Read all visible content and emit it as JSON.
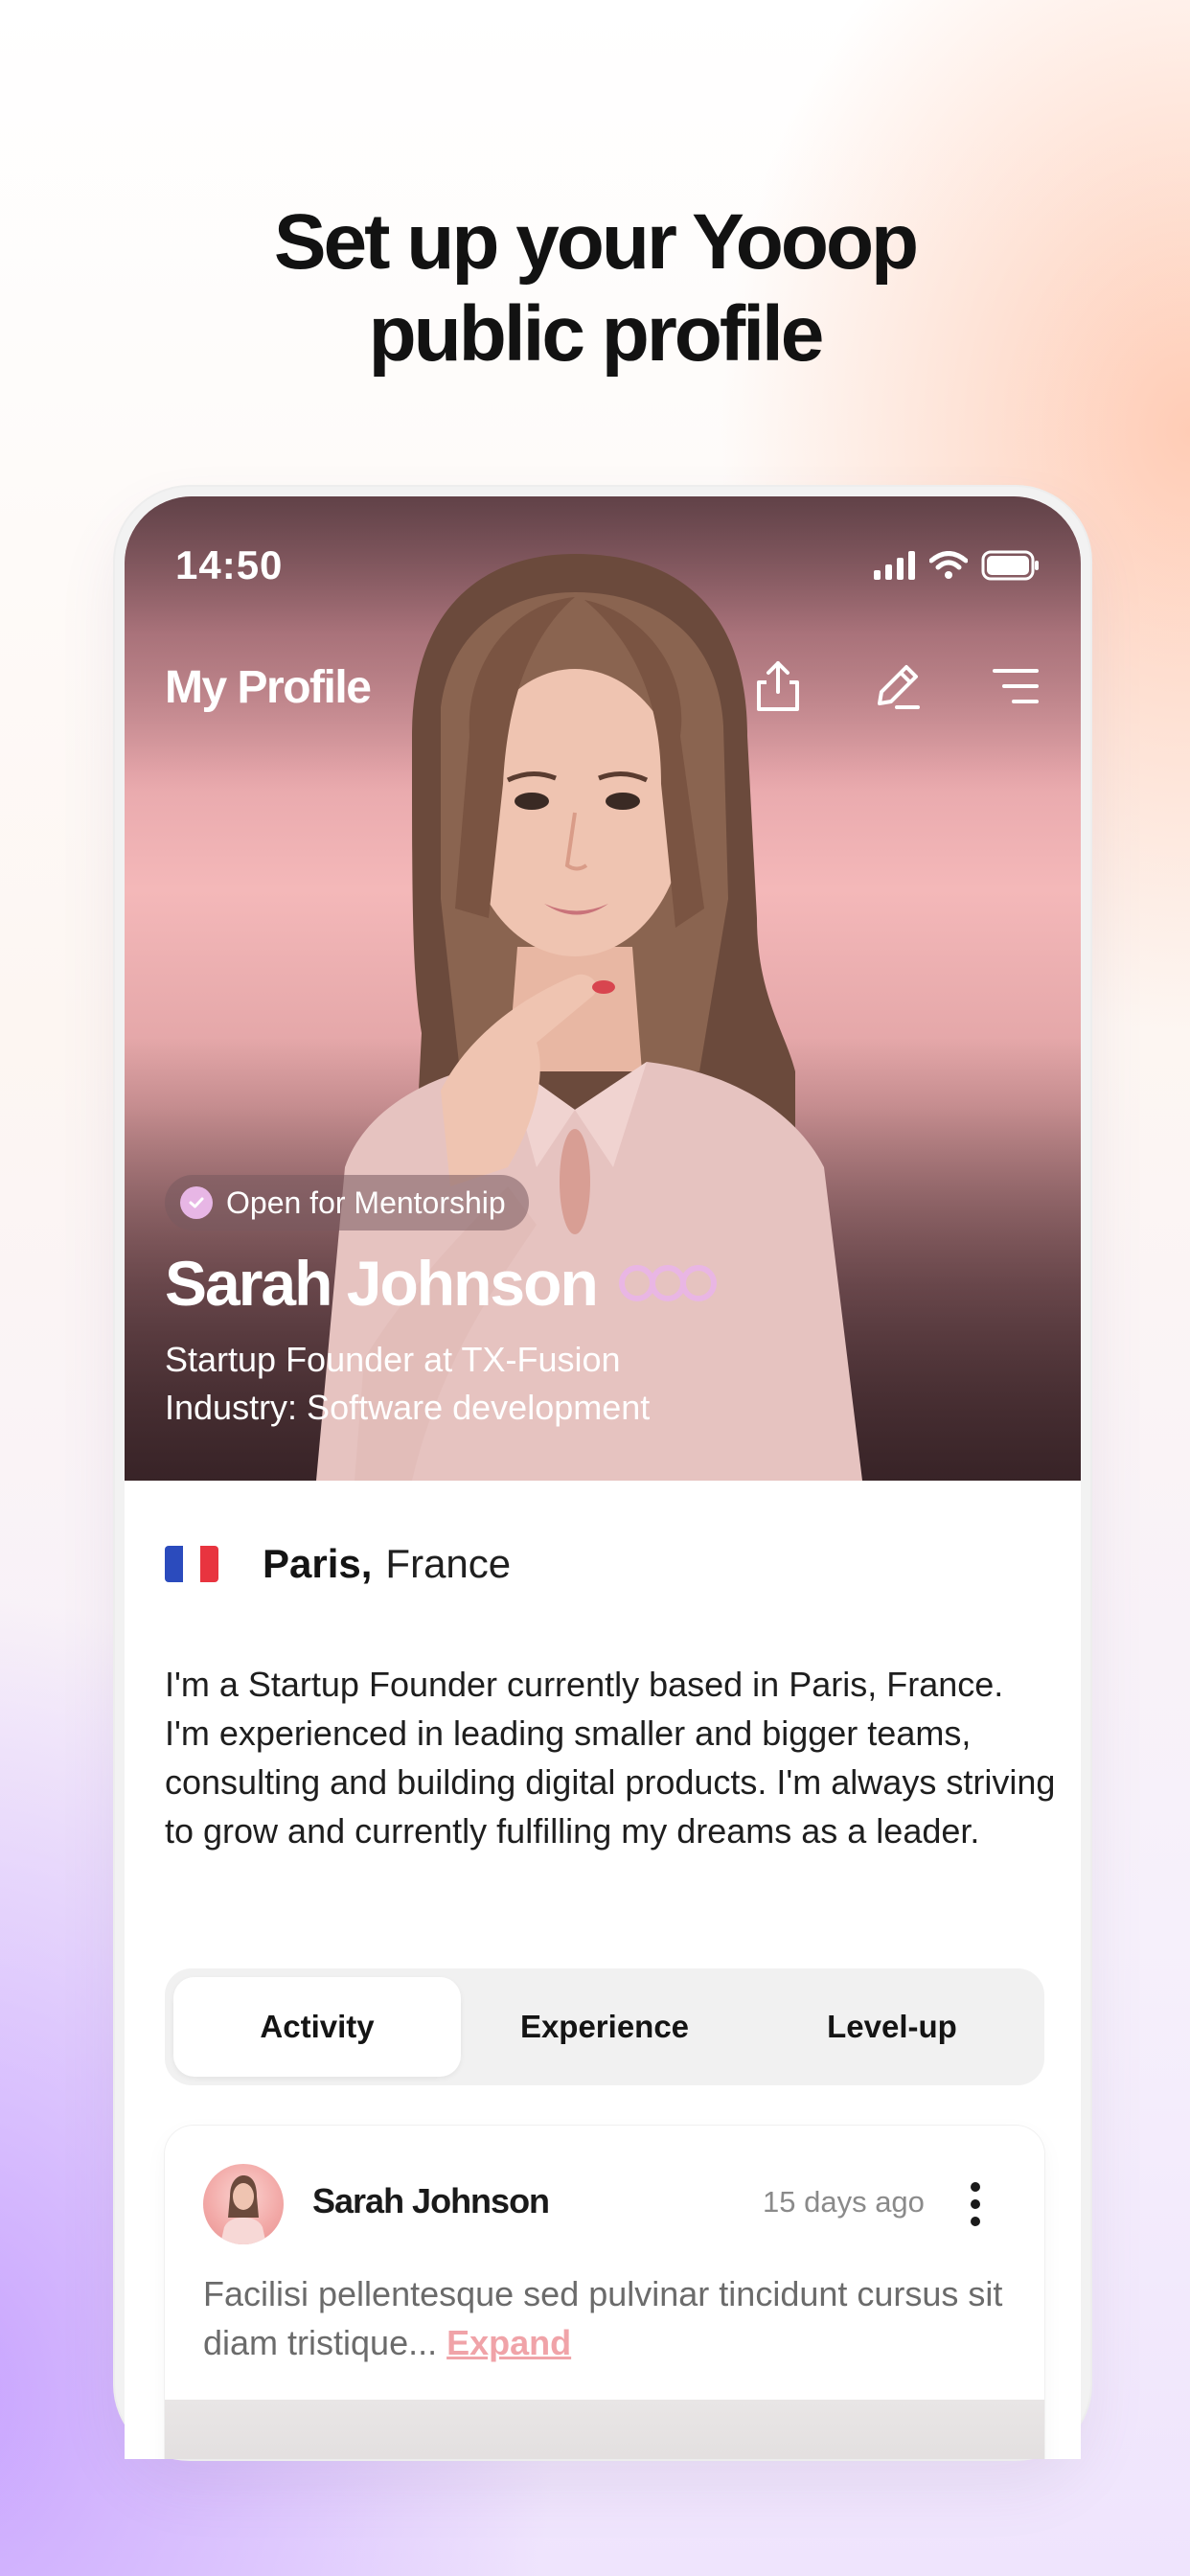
{
  "headline": {
    "line1": "Set up your  Yooop",
    "line2": "public profile"
  },
  "status_bar": {
    "time": "14:50",
    "icons": [
      "signal-icon",
      "wifi-icon",
      "battery-icon"
    ]
  },
  "header": {
    "title": "My Profile",
    "actions": [
      {
        "icon": "share-icon"
      },
      {
        "icon": "edit-icon"
      },
      {
        "icon": "menu-icon"
      }
    ]
  },
  "profile": {
    "badge": "Open for Mentorship",
    "name": "Sarah Johnson",
    "headline": "Startup Founder at TX-Fusion",
    "industry": "Industry: Software development",
    "city": "Paris",
    "country": "France",
    "bio": "I'm a Startup Founder currently based in Paris, France. I'm experienced in leading smaller and bigger teams, consulting and building digital products. I'm always striving to grow and currently fulfilling my dreams as a leader."
  },
  "tabs": [
    {
      "label": "Activity",
      "active": true
    },
    {
      "label": "Experience",
      "active": false
    },
    {
      "label": "Level-up",
      "active": false
    }
  ],
  "post": {
    "author": "Sarah Johnson",
    "time": "15 days ago",
    "text": "Facilisi pellentesque sed pulvinar tincidunt cursus sit diam tristique... ",
    "expand_label": "Expand"
  },
  "colors": {
    "accent_pink": "#f0a3a8",
    "badge_check": "#e7b6e5",
    "infinity_logo": "#e9b6e4",
    "tab_bg": "#f1f1f1"
  }
}
